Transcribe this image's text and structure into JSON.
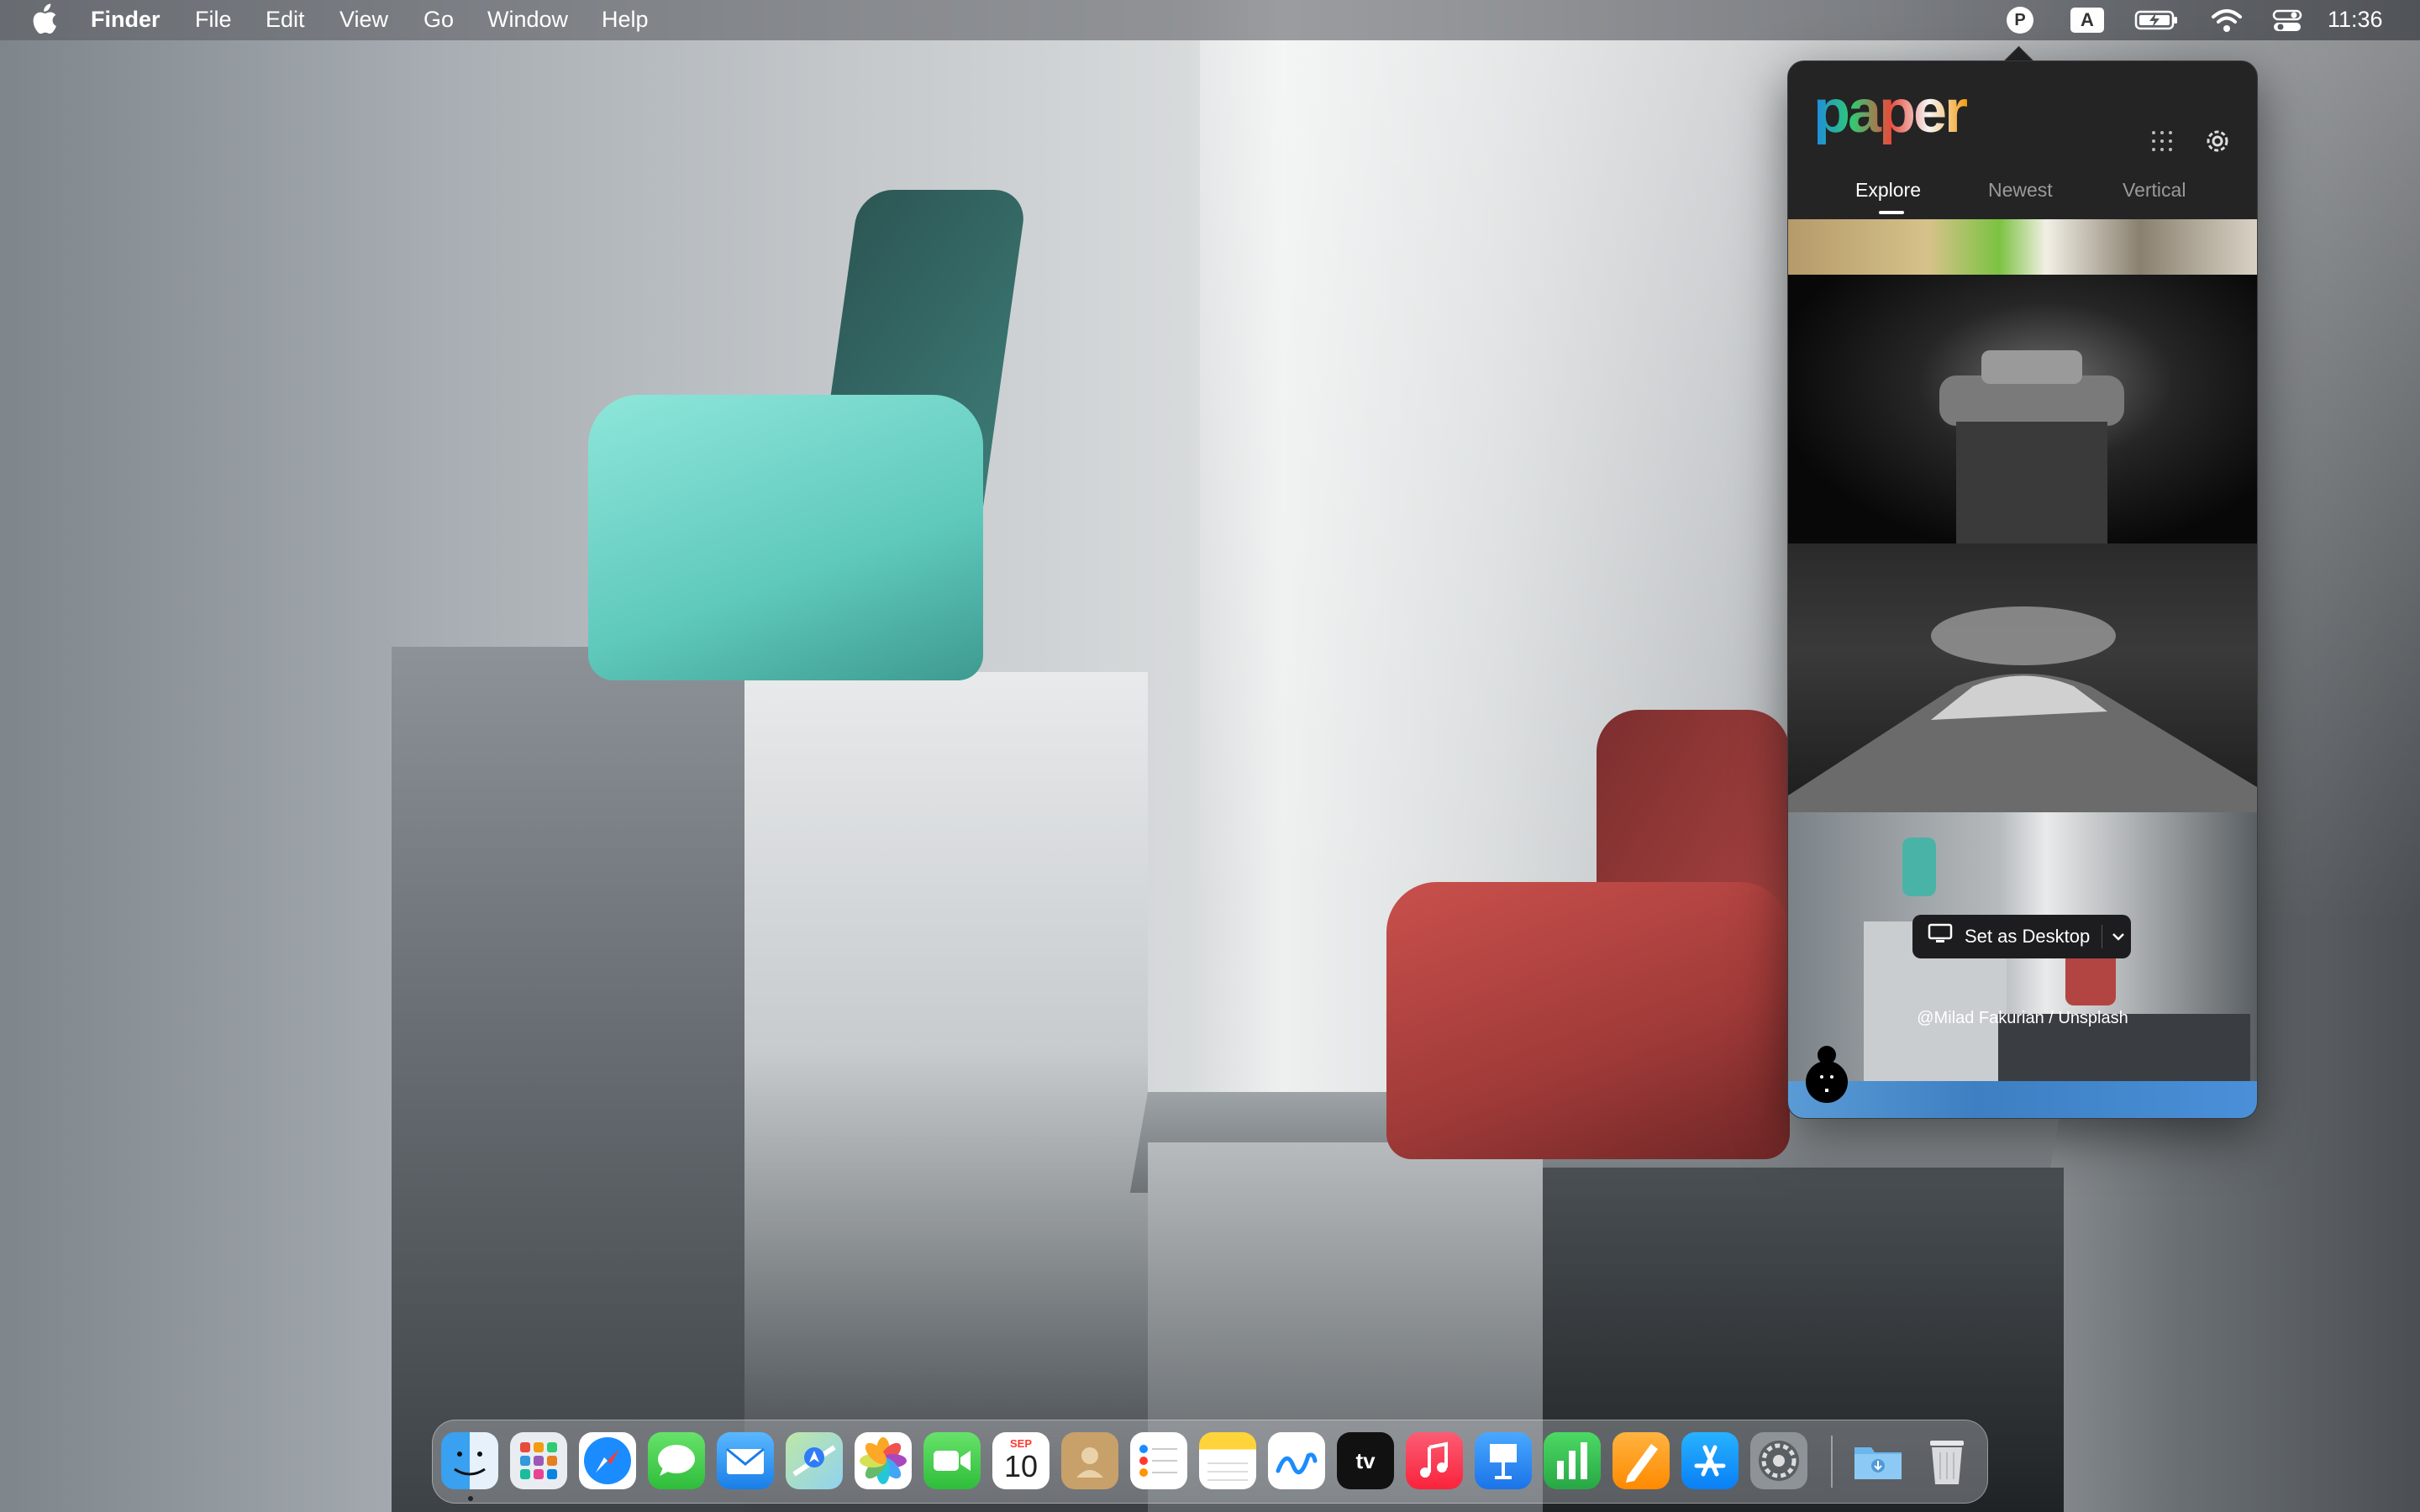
{
  "menubar": {
    "apple_icon": "apple-logo-icon",
    "app_name": "Finder",
    "menus": [
      "File",
      "Edit",
      "View",
      "Go",
      "Window",
      "Help"
    ],
    "tray": {
      "paper_badge": "P",
      "input_badge": "A",
      "icons": [
        "battery-charging-icon",
        "wifi-icon",
        "control-center-icon"
      ],
      "time": "11:36"
    }
  },
  "paper_app": {
    "logo": "paper",
    "tabs": [
      "Explore",
      "Newest",
      "Vertical"
    ],
    "active_tab": "Explore",
    "set_desktop_label": "Set as Desktop",
    "credit": "@Milad Fakurian / Unsplash",
    "thumbnails": [
      "car-wheel-photo",
      "water-tower-photo",
      "mount-fuji-photo",
      "chairs-photo",
      "blue-pattern-photo"
    ]
  },
  "dock": {
    "apps": [
      "Finder",
      "Launchpad",
      "Safari",
      "Messages",
      "Mail",
      "Maps",
      "Photos",
      "FaceTime",
      "Calendar",
      "Contacts",
      "Reminders",
      "Notes",
      "Freeform",
      "TV",
      "Music",
      "Keynote",
      "Numbers",
      "Pages",
      "App Store",
      "System Settings",
      "Downloads",
      "Trash"
    ],
    "calendar_month": "SEP",
    "calendar_day": "10",
    "tv_label": "tv"
  }
}
